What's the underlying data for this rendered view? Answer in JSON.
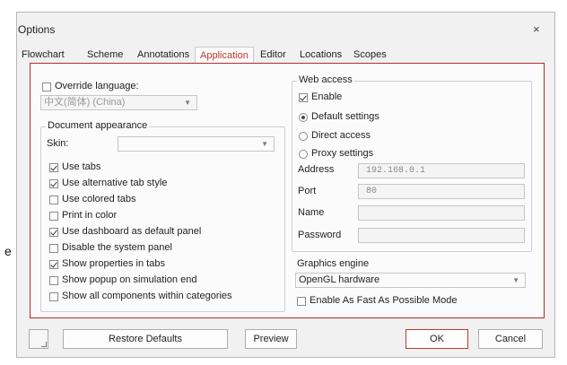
{
  "background": {
    "fragment": "e"
  },
  "dialog": {
    "title": "Options",
    "close": "×"
  },
  "tabs": [
    "Flowchart",
    "Scheme",
    "Annotations",
    "Application",
    "Editor",
    "Locations",
    "Scopes"
  ],
  "active_tab": "Application",
  "left": {
    "override_language": {
      "label": "Override language:",
      "checked": false
    },
    "language_combo": {
      "value": "中文(简体) (China)",
      "arrow": "▼"
    },
    "document_appearance": {
      "title": "Document appearance",
      "skin_label": "Skin:",
      "skin_value": "",
      "skin_arrow": "▼",
      "options": [
        {
          "label": "Use tabs",
          "checked": true
        },
        {
          "label": "Use alternative tab style",
          "checked": true
        },
        {
          "label": "Use colored tabs",
          "checked": false
        },
        {
          "label": "Print in color",
          "checked": false
        },
        {
          "label": "Use dashboard as default panel",
          "checked": true
        },
        {
          "label": "Disable the system panel",
          "checked": false
        },
        {
          "label": "Show properties in tabs",
          "checked": true
        },
        {
          "label": "Show popup on simulation end",
          "checked": false
        },
        {
          "label": "Show all components within categories",
          "checked": false
        }
      ]
    }
  },
  "right": {
    "web_access": {
      "title": "Web access",
      "enable": {
        "label": "Enable",
        "checked": true
      },
      "radios": [
        {
          "label": "Default settings",
          "selected": true
        },
        {
          "label": "Direct access",
          "selected": false
        },
        {
          "label": "Proxy settings",
          "selected": false
        }
      ],
      "fields": [
        {
          "label": "Address",
          "value": "192.168.0.1"
        },
        {
          "label": "Port",
          "value": "80"
        },
        {
          "label": "Name",
          "value": ""
        },
        {
          "label": "Password",
          "value": ""
        }
      ]
    },
    "graphics_engine": {
      "label": "Graphics engine",
      "value": "OpenGL hardware",
      "arrow": "▼"
    },
    "fast_mode": {
      "label": "Enable As Fast As Possible Mode",
      "checked": false
    }
  },
  "buttons": {
    "restore": "Restore Defaults",
    "preview": "Preview",
    "ok": "OK",
    "cancel": "Cancel"
  }
}
